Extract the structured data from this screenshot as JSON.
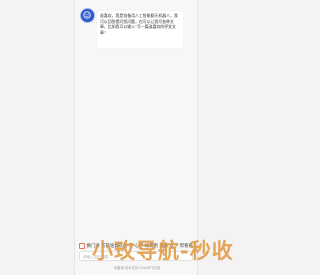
{
  "chat": {
    "assistant_message": "谁喜欢，我是准备用人工智能聊天机器人，我可以回答提问您问题，也可以让我写各种文章，比如我可以输入“写一篇谁喜欢的抒发文章”"
  },
  "shortcut": {
    "label": "换门讲  写篇谁喜欢的 写 心字 如需用 准备 以下 帮看看"
  },
  "input": {
    "placeholder": "请输入您的问题..."
  },
  "footer": {
    "text": "粤备案 技术支持 ChatGPT应用"
  },
  "watermark": {
    "text": "小玫导航-秒收"
  },
  "colors": {
    "avatar": "#2f58c9",
    "watermark": "#e0963c"
  }
}
